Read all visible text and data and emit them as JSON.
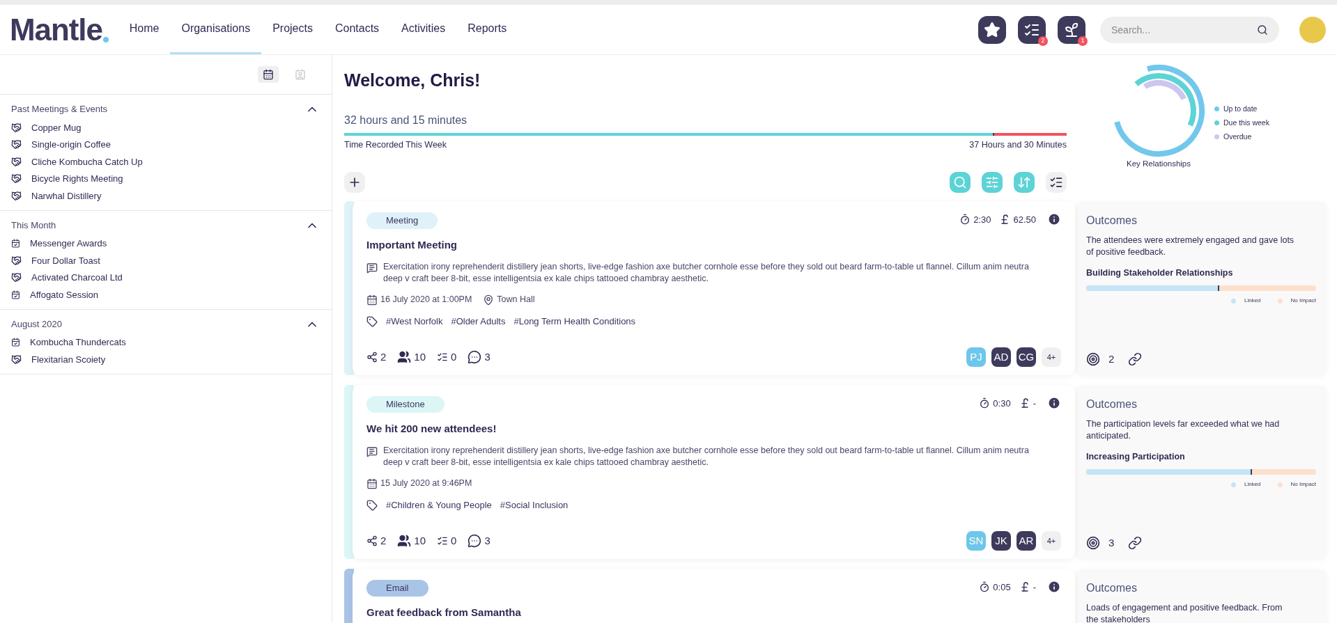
{
  "header": {
    "logo": "Mantle",
    "nav": [
      {
        "label": "Home",
        "selected": false
      },
      {
        "label": "Organisations",
        "selected": true
      },
      {
        "label": "Projects",
        "selected": false
      },
      {
        "label": "Contacts",
        "selected": false
      },
      {
        "label": "Activities",
        "selected": false
      },
      {
        "label": "Reports",
        "selected": false
      }
    ],
    "actions": [
      {
        "kind": "favourites"
      },
      {
        "kind": "tasks",
        "badge": "2"
      },
      {
        "kind": "growth",
        "badge": "1"
      }
    ],
    "search": {
      "placeholder": "Search..."
    }
  },
  "sidebar": {
    "view_toggle": [
      {
        "kind": "calendar",
        "selected": true
      },
      {
        "kind": "contacts",
        "selected": false
      }
    ],
    "sections": [
      {
        "title": "Past Meetings & Events",
        "expanded": true,
        "items": [
          {
            "label": "Copper Mug",
            "kind": "meeting"
          },
          {
            "label": "Single-origin Coffee",
            "kind": "meeting"
          },
          {
            "label": "Cliche Kombucha Catch Up",
            "kind": "meeting"
          },
          {
            "label": "Bicycle Rights Meeting",
            "kind": "meeting"
          },
          {
            "label": "Narwhal Distillery",
            "kind": "meeting"
          }
        ]
      },
      {
        "title": "This Month",
        "expanded": true,
        "items": [
          {
            "label": "Messenger Awards",
            "kind": "event"
          },
          {
            "label": "Four Dollar Toast",
            "kind": "meeting"
          },
          {
            "label": "Activated Charcoal Ltd",
            "kind": "meeting"
          },
          {
            "label": "Affogato Session",
            "kind": "event"
          }
        ]
      },
      {
        "title": "August 2020",
        "expanded": true,
        "items": [
          {
            "label": "Kombucha Thundercats",
            "kind": "event"
          },
          {
            "label": "Flexitarian Scoiety",
            "kind": "meeting"
          }
        ]
      }
    ]
  },
  "main": {
    "greeting": "Welcome, Chris!",
    "time": {
      "recorded": "32 hours and 15 minutes",
      "level": 0.9,
      "label": "Time Recorded This Week",
      "target": "37 Hours and 30 Minutes"
    },
    "key_relationships": {
      "title": "Key Relationships",
      "legend": [
        {
          "label": "Up to date",
          "color": "#72c7ec"
        },
        {
          "label": "Due this week",
          "color": "#5dd3d6"
        },
        {
          "label": "Overdue",
          "color": "#cdc7ef"
        }
      ]
    },
    "toolbar": [
      {
        "kind": "add",
        "active": false
      },
      {
        "kind": "search",
        "active": true
      },
      {
        "kind": "filter",
        "active": true
      },
      {
        "kind": "sort",
        "active": true
      },
      {
        "kind": "checklist",
        "active": false
      }
    ],
    "activities": [
      {
        "type": "Meeting",
        "color": "#dff1f9",
        "title": "Important Meeting",
        "description": "Exercitation irony reprehenderit distillery jean shorts, live-edge fashion axe butcher cornhole esse before they sold out beard farm-to-table ut flannel. Cillum anim neutra deep v craft beer 8-bit, esse intelligentsia ex kale chips tattooed chambray aesthetic.",
        "date": "16 July 2020 at 1:00PM",
        "location": "Town Hall",
        "tags": [
          "#West Norfolk",
          "#Older Adults",
          "#Long Term Health Conditions"
        ],
        "duration": "2:30",
        "cost": "62.50",
        "shares": "2",
        "attendees": "10",
        "tasks": "0",
        "comments": "3",
        "people": [
          {
            "initials": "PJ",
            "color": "#6ec6ea"
          },
          {
            "initials": "AD",
            "color": "#3d3a5c"
          },
          {
            "initials": "CG",
            "color": "#3d3a5c"
          }
        ],
        "more": "4+",
        "outcome": {
          "title": "Outcomes",
          "text": "The attendees were extremely engaged and gave lots of positive feedback.",
          "measure": "Building Stakeholder Relationships",
          "level": 0.58,
          "legend": [
            {
              "label": "Linked",
              "color": "#c3e5f6"
            },
            {
              "label": "No Impact",
              "color": "#fde0cb"
            }
          ],
          "impacts": "2"
        }
      },
      {
        "type": "Milestone",
        "color": "#dcf6f6",
        "title": "We hit 200 new attendees!",
        "description": "Exercitation irony reprehenderit distillery jean shorts, live-edge fashion axe butcher cornhole esse before they sold out beard farm-to-table ut flannel. Cillum anim neutra deep v craft beer 8-bit, esse intelligentsia ex kale chips tattooed chambray aesthetic.",
        "date": "15 July 2020 at 9:46PM",
        "tags": [
          "#Children & Young People",
          "#Social Inclusion"
        ],
        "duration": "0:30",
        "cost": "-",
        "shares": "2",
        "attendees": "10",
        "tasks": "0",
        "comments": "3",
        "people": [
          {
            "initials": "SN",
            "color": "#6ec6ea"
          },
          {
            "initials": "JK",
            "color": "#3d3a5c"
          },
          {
            "initials": "AR",
            "color": "#3d3a5c"
          }
        ],
        "more": "4+",
        "outcome": {
          "title": "Outcomes",
          "text": "The participation levels far exceeded what we had anticipated.",
          "measure": "Increasing Participation",
          "level": 0.72,
          "legend": [
            {
              "label": "Linked",
              "color": "#c3e5f6"
            },
            {
              "label": "No Impact",
              "color": "#fde0cb"
            }
          ],
          "impacts": "3"
        }
      },
      {
        "type": "Email",
        "color": "#a9c4e6",
        "title": "Great feedback from Samantha",
        "duration": "0:05",
        "cost": "-",
        "outcome": {
          "title": "Outcomes",
          "text": "Loads of engagement and positive feedback. From the stakeholders"
        }
      }
    ]
  }
}
